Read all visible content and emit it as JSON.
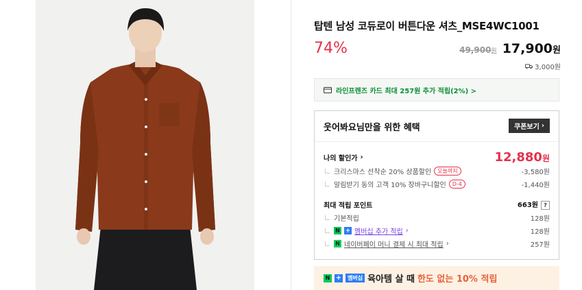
{
  "product": {
    "title": "탑텐 남성 코듀로이 버튼다운 셔츠_MSE4WC1001",
    "discount": "74%",
    "original_price": "49,900",
    "original_unit": "원",
    "sale_price": "17,900",
    "sale_unit": "원",
    "shipping": "3,000원"
  },
  "card_banner": {
    "text": "라인프렌즈 카드 최대 257원 추가 적립(2%) >"
  },
  "benefit": {
    "heading": "웃어봐요님만을 위한 혜택",
    "coupon_button": "쿠폰보기",
    "my_price_label": "나의 할인가",
    "my_price": "12,880",
    "my_price_unit": "원",
    "discounts": [
      {
        "label": "크리스마스 선착순 20% 상품할인",
        "tag": "오늘까지",
        "value": "-3,580원"
      },
      {
        "label": "알림받기 동의 고객 10% 장바구니할인",
        "tag": "D-4",
        "value": "-1,440원"
      }
    ],
    "points_label": "최대 적립 포인트",
    "points_value": "663원",
    "points_help": "?",
    "points": [
      {
        "label": "기본적립",
        "value": "128원"
      },
      {
        "label": "멤버십 추가 적립",
        "value": "128원"
      },
      {
        "label": "네이버페이 머니 결제 시 최대 적립",
        "value": "257원"
      }
    ]
  },
  "promo": {
    "badge_n": "N",
    "badge_plus": "+",
    "badge_membership": "멤버십",
    "text1": "육아템 살 때",
    "text2": "한도 없는 10% 적립"
  },
  "colors": {
    "accent_red": "#e2324b",
    "naver_green": "#03c75a",
    "membership_blue": "#2d7df6",
    "shirt_rust": "#8a3a1a"
  }
}
